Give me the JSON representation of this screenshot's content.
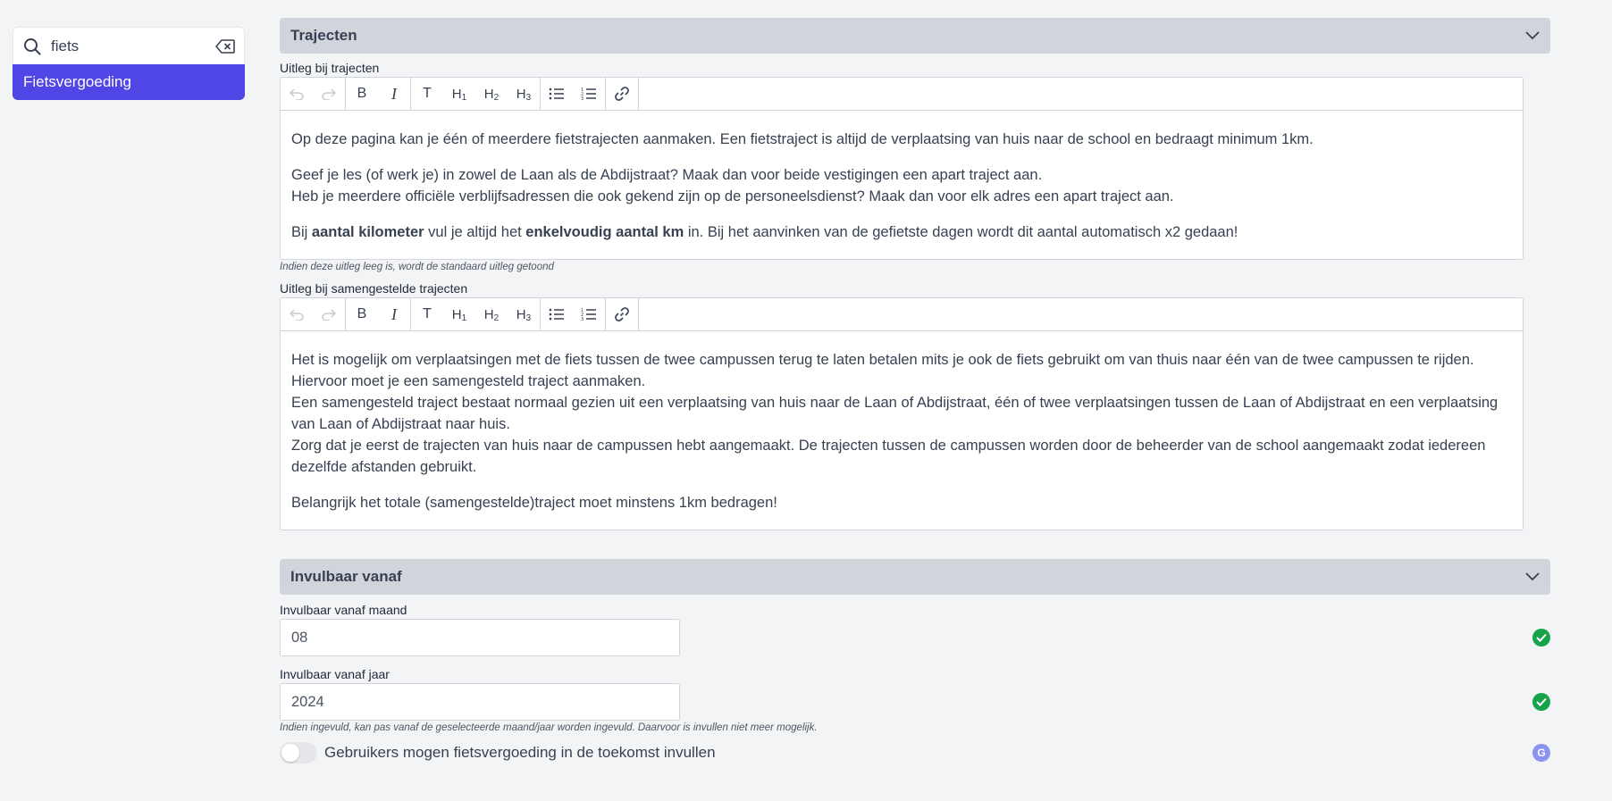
{
  "search": {
    "value": "fiets",
    "result": "Fietsvergoeding"
  },
  "sections": {
    "trajecten": {
      "title": "Trajecten"
    },
    "invulbaar": {
      "title": "Invulbaar vanaf"
    }
  },
  "editor1": {
    "label": "Uitleg bij trajecten",
    "p1": "Op deze pagina kan je één of meerdere fietstrajecten aanmaken. Een fietstraject is altijd de verplaatsing van huis naar de school en bedraagt minimum 1km.",
    "p2a": "Geef je les (of werk je) in zowel de Laan als de Abdijstraat? Maak dan voor beide vestigingen een apart traject aan.",
    "p2b": "Heb je meerdere officiële verblijfsadressen die ook gekend zijn op de personeelsdienst? Maak dan voor elk adres een apart traject aan.",
    "p3_pre": "Bij ",
    "p3_b1": "aantal kilometer",
    "p3_mid": " vul je altijd het ",
    "p3_b2": "enkelvoudig aantal km",
    "p3_post": " in. Bij het aanvinken van de gefietste dagen wordt dit aantal automatisch x2 gedaan!",
    "help": "Indien deze uitleg leeg is, wordt de standaard uitleg getoond"
  },
  "editor2": {
    "label": "Uitleg bij samengestelde trajecten",
    "l1": "Het is mogelijk om verplaatsingen met de fiets tussen de twee campussen terug te laten betalen mits je ook de fiets gebruikt om van thuis naar één van de twee campussen te rijden. Hiervoor moet je een samengesteld traject aanmaken.",
    "l2": "Een samengesteld traject bestaat normaal gezien uit een verplaatsing van huis naar de Laan of Abdijstraat, één of twee verplaatsingen tussen de Laan of Abdijstraat en een verplaatsing van Laan of Abdijstraat naar huis.",
    "l3": "Zorg dat je eerst de trajecten van huis naar de campussen hebt aangemaakt. De trajecten tussen de campussen worden door de beheerder van de school aangemaakt zodat iedereen dezelfde afstanden gebruikt.",
    "p2": "Belangrijk het totale (samengestelde)traject moet minstens 1km bedragen!"
  },
  "toolbar": {
    "bold": "B",
    "italic": "I",
    "text": "T",
    "h1": "H",
    "h1n": "1",
    "h2": "H",
    "h2n": "2",
    "h3": "H",
    "h3n": "3"
  },
  "maand": {
    "label": "Invulbaar vanaf maand",
    "value": "08"
  },
  "jaar": {
    "label": "Invulbaar vanaf jaar",
    "value": "2024",
    "help": "Indien ingevuld, kan pas vanaf de geselecteerde maand/jaar worden ingevuld. Daarvoor is invullen niet meer mogelijk."
  },
  "toggle": {
    "label": "Gebruikers mogen fietsvergoeding in de toekomst invullen",
    "badge": "G",
    "on": false
  }
}
